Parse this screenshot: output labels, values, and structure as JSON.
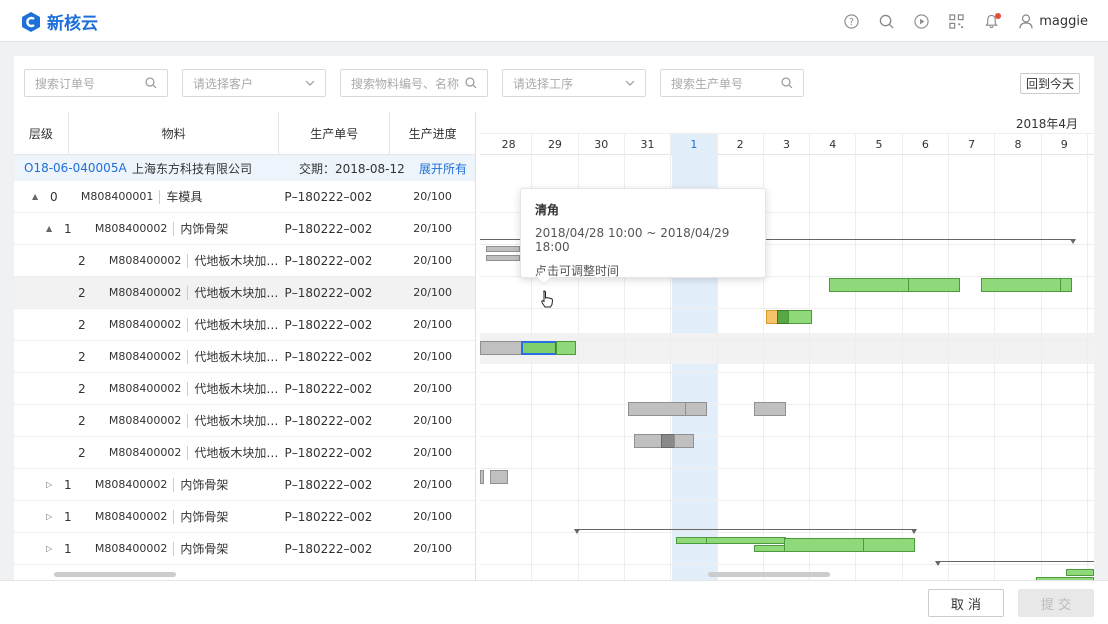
{
  "app": {
    "name": "新核云",
    "brand_color": "#1e6fd9"
  },
  "topbar": {
    "icons": [
      "help-icon",
      "search-icon",
      "play-icon",
      "qrcode-icon",
      "bell-icon",
      "user-icon"
    ],
    "username": "maggie"
  },
  "filters": {
    "order_search": "搜索订单号",
    "customer_select": "请选择客户",
    "material_search": "搜索物料编号、名称",
    "process_select": "请选择工序",
    "po_search": "搜索生产单号",
    "today_button": "回到今天"
  },
  "grid": {
    "columns": [
      "层级",
      "物料",
      "生产单号",
      "生产进度"
    ],
    "order": {
      "code": "O18-06-040005A",
      "customer": "上海东方科技有限公司",
      "due": "交期：2018-08-12",
      "expand_all": "展开所有"
    },
    "rows": [
      {
        "caret": "▲",
        "level": "0",
        "code": "M808400001",
        "name": "车模具",
        "po": "P–180222–002",
        "progress": "20/100"
      },
      {
        "caret": "▲",
        "level": "1",
        "code": "M808400002",
        "name": "内饰骨架",
        "po": "P–180222–002",
        "progress": "20/100"
      },
      {
        "caret": "",
        "level": "2",
        "code": "M808400002",
        "name": "代地板木块加…",
        "po": "P–180222–002",
        "progress": "20/100"
      },
      {
        "caret": "",
        "level": "2",
        "code": "M808400002",
        "name": "代地板木块加…",
        "po": "P–180222–002",
        "progress": "20/100"
      },
      {
        "caret": "",
        "level": "2",
        "code": "M808400002",
        "name": "代地板木块加…",
        "po": "P–180222–002",
        "progress": "20/100"
      },
      {
        "caret": "",
        "level": "2",
        "code": "M808400002",
        "name": "代地板木块加…",
        "po": "P–180222–002",
        "progress": "20/100"
      },
      {
        "caret": "",
        "level": "2",
        "code": "M808400002",
        "name": "代地板木块加…",
        "po": "P–180222–002",
        "progress": "20/100"
      },
      {
        "caret": "",
        "level": "2",
        "code": "M808400002",
        "name": "代地板木块加…",
        "po": "P–180222–002",
        "progress": "20/100"
      },
      {
        "caret": "",
        "level": "2",
        "code": "M808400002",
        "name": "代地板木块加…",
        "po": "P–180222–002",
        "progress": "20/100"
      },
      {
        "caret": "▷",
        "level": "1",
        "code": "M808400002",
        "name": "内饰骨架",
        "po": "P–180222–002",
        "progress": "20/100"
      },
      {
        "caret": "▷",
        "level": "1",
        "code": "M808400002",
        "name": "内饰骨架",
        "po": "P–180222–002",
        "progress": "20/100"
      },
      {
        "caret": "▷",
        "level": "1",
        "code": "M808400002",
        "name": "内饰骨架",
        "po": "P–180222–002",
        "progress": "20/100"
      }
    ]
  },
  "gantt": {
    "month_label": "2018年4月",
    "days": [
      "28",
      "29",
      "30",
      "31",
      "1",
      "2",
      "3",
      "4",
      "5",
      "6",
      "7",
      "8",
      "9"
    ],
    "today_label": "1",
    "today_color": "#e3eefb"
  },
  "tooltip": {
    "title": "清角",
    "time_range": "2018/04/28 10:00 ~ 2018/04/29 18:00",
    "hint": "点击可调整时间"
  },
  "footer": {
    "cancel": "取 消",
    "submit": "提 交"
  }
}
